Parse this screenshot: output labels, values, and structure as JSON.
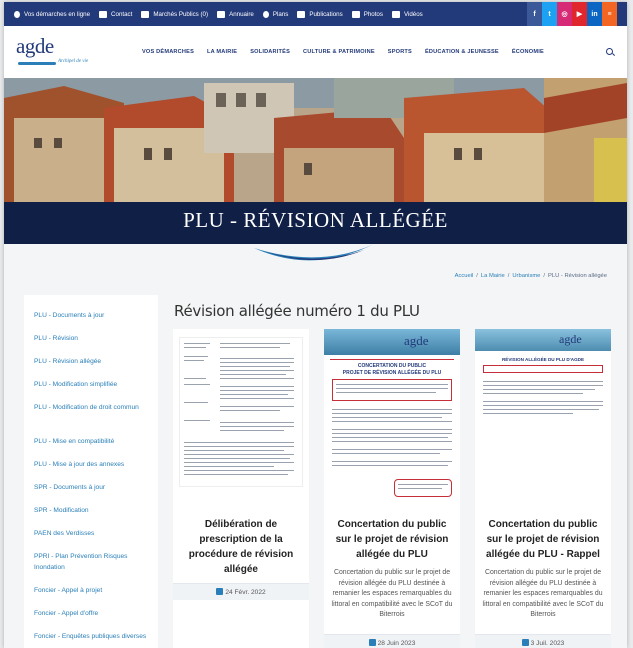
{
  "topbar": {
    "items": [
      "Vos démarches en ligne",
      "Contact",
      "Marchés Publics (0)",
      "Annuaire",
      "Plans",
      "Publications",
      "Photos",
      "Vidéos"
    ],
    "social": [
      {
        "label": "f",
        "color": "#3b5998"
      },
      {
        "label": "t",
        "color": "#1da1f2"
      },
      {
        "label": "◎",
        "color": "#d62976"
      },
      {
        "label": "▶",
        "color": "#e0272e"
      },
      {
        "label": "in",
        "color": "#0a66c2"
      },
      {
        "label": "≡",
        "color": "#f26522"
      }
    ]
  },
  "header": {
    "logo": "agde",
    "logo_sub": "Archipel de vie",
    "nav": [
      "VOS DÉMARCHES",
      "LA MAIRIE",
      "SOLIDARITÉS",
      "CULTURE & PATRIMOINE",
      "SPORTS",
      "ÉDUCATION & JEUNESSE",
      "ÉCONOMIE"
    ]
  },
  "hero": {
    "title": "PLU - RÉVISION ALLÉGÉE"
  },
  "breadcrumb": [
    "Accueil",
    "/",
    "La Mairie",
    "/",
    "Urbanisme",
    "/",
    "PLU - Révision allégée"
  ],
  "sidebar": {
    "items": [
      "PLU - Documents à jour",
      "PLU - Révision",
      "PLU - Révision allégée",
      "PLU - Modification simplifiée",
      "PLU - Modification de droit commun",
      "PLU - Mise en compatibilité",
      "PLU - Mise à jour des annexes",
      "SPR - Documents à jour",
      "SPR - Modification",
      "PAEN des Verdisses",
      "PPRI - Plan Prévention Risques Inondation",
      "Foncier - Appel à projet",
      "Foncier - Appel d'offre",
      "Foncier - Enquêtes publiques diverses"
    ]
  },
  "main": {
    "title": "Révision allégée numéro 1 du PLU",
    "cards": [
      {
        "title": "Délibération de prescription de la procédure de révision allégée",
        "desc": "",
        "date": "24 Févr. 2022"
      },
      {
        "title": "Concertation du public sur le projet de révision allégée du PLU",
        "desc": "Concertation du public sur le projet de révision allégée du PLU destinée à remanier les espaces remarquables du littoral en compatibilité avec le SCoT du Biterrois",
        "date": "28 Juin 2023",
        "doc_heading": "CONCERTATION DU PUBLIC",
        "doc_sub": "PROJET DE RÉVISION ALLÉGÉE DU PLU"
      },
      {
        "title": "Concertation du public sur le projet de révision allégée du PLU - Rappel",
        "desc": "Concertation du public sur le projet de révision allégée du PLU destinée à remanier les espaces remarquables du littoral en compatibilité avec le SCoT du Biterrois",
        "date": "3 Juil. 2023",
        "doc_heading": "RÉVISION ALLÉGÉE DU PLU D'AGDE"
      }
    ]
  }
}
